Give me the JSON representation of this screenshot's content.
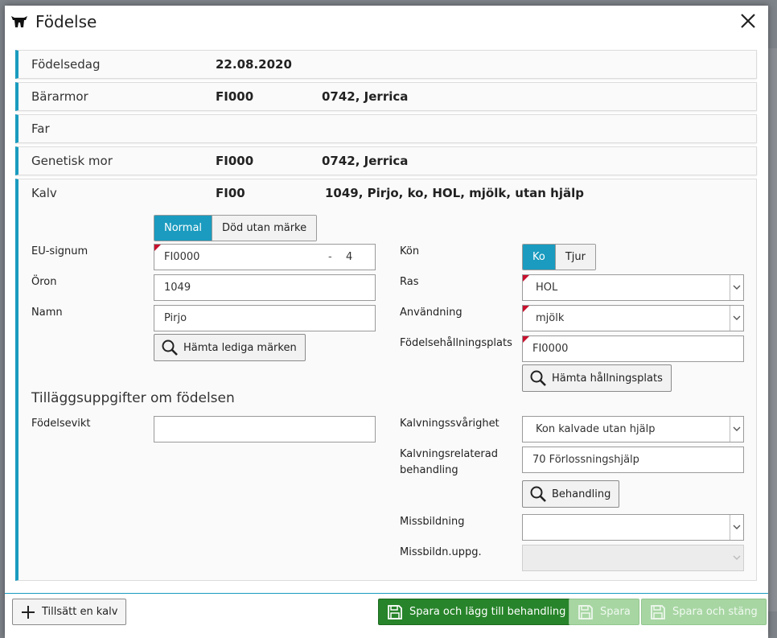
{
  "dialog": {
    "title": "Födelse",
    "icon": "cow-icon"
  },
  "rows": {
    "birthdate": {
      "label": "Födelsedag",
      "value": "22.08.2020"
    },
    "carrier": {
      "label": "Bärarmor",
      "value": "FI000",
      "name": "0742, Jerrica"
    },
    "father": {
      "label": "Far"
    },
    "genetic_mother": {
      "label": "Genetisk mor",
      "value": "FI000",
      "name": "0742, Jerrica"
    }
  },
  "calf": {
    "label": "Kalv",
    "value": "FI00",
    "summary": "1049, Pirjo, ko, HOL, mjölk, utan hjälp",
    "status_segment": {
      "options": [
        "Normal",
        "Död utan märke"
      ],
      "selected": "Normal"
    },
    "fields": {
      "eu_signum": {
        "label": "EU-signum",
        "value": "FI0000",
        "dash": "-",
        "check": "4"
      },
      "ear": {
        "label": "Öron",
        "value": "1049"
      },
      "name": {
        "label": "Namn",
        "value": "Pirjo"
      },
      "fetch_tags_button": "Hämta lediga märken",
      "sex": {
        "label": "Kön",
        "options": [
          "Ko",
          "Tjur"
        ],
        "selected": "Ko"
      },
      "breed": {
        "label": "Ras",
        "value": "HOL"
      },
      "usage": {
        "label": "Användning",
        "value": "mjölk"
      },
      "birth_holding": {
        "label": "Födelsehållningsplats",
        "value": "FI0000"
      },
      "fetch_holding_button": "Hämta hållningsplats"
    },
    "extra": {
      "title": "Tilläggsuppgifter om födelsen",
      "birth_weight": {
        "label": "Födelsevikt",
        "value": ""
      },
      "calving_difficulty": {
        "label": "Kalvningssvårighet",
        "value": "Kon kalvade utan hjälp"
      },
      "calving_treatment": {
        "label_line1": "Kalvningsrelaterad",
        "label_line2": "behandling",
        "value": "70 Förlossningshjälp"
      },
      "treatment_button": "Behandling",
      "malformation": {
        "label": "Missbildning",
        "value": ""
      },
      "malformation_info": {
        "label": "Missbildn.uppg.",
        "value": ""
      }
    }
  },
  "footer": {
    "add_calf": "Tillsätt en kalv",
    "save_and_treat": "Spara och lägg till behandling",
    "save": "Spara",
    "save_and_close": "Spara och stäng"
  },
  "colors": {
    "accent": "#1a9bbf",
    "required_marker": "#c8102e",
    "primary_green": "#27842a",
    "disabled_green": "#a7d6a3"
  }
}
